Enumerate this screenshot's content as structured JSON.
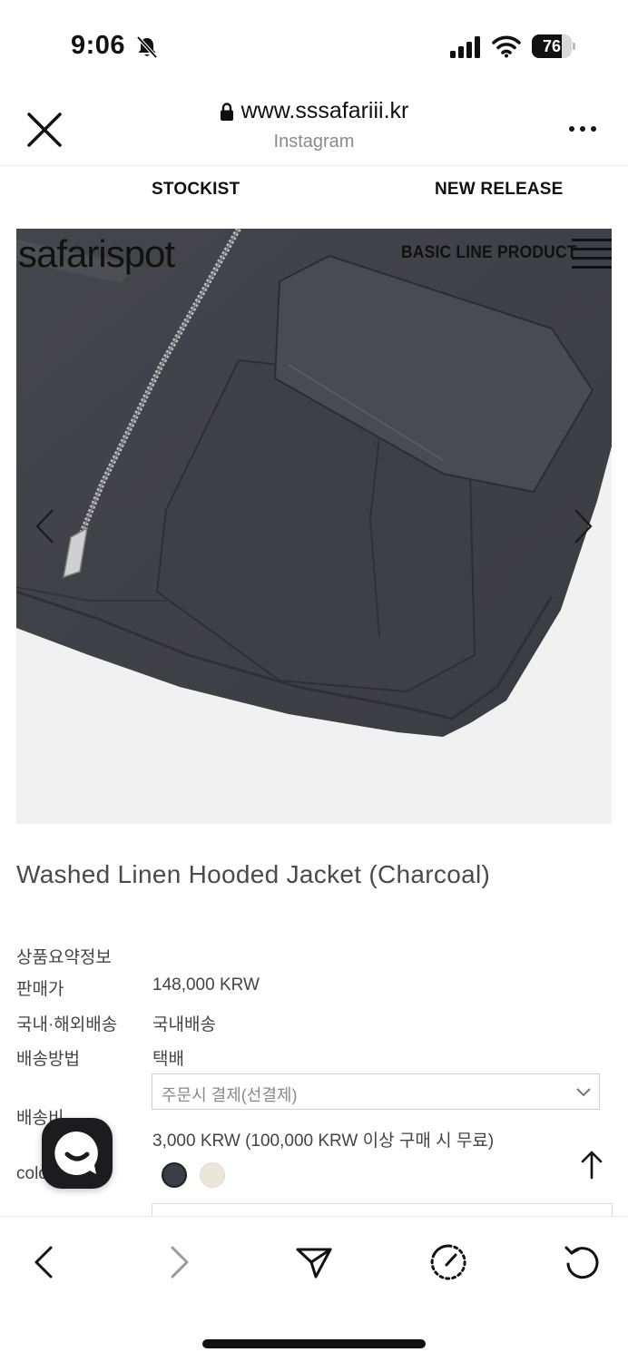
{
  "status_bar": {
    "time": "9:06",
    "battery": "76",
    "battery_percent": 76
  },
  "browser": {
    "url": "www.sssafariii.kr",
    "source": "Instagram"
  },
  "site_nav": {
    "stockist": "STOCKIST",
    "new_release": "NEW RELEASE"
  },
  "hero": {
    "brand": "safarispot",
    "line": "BASIC LINE PRODUCT"
  },
  "product": {
    "title": "Washed Linen Hooded Jacket (Charcoal)",
    "summary_label": "상품요약정보",
    "price_label": "판매가",
    "price_value": "148,000 KRW",
    "shipping_scope_label": "국내·해외배송",
    "shipping_scope_value": "국내배송",
    "shipping_method_label": "배송방법",
    "shipping_method_value": "택배",
    "shipping_fee_label": "배송비",
    "shipping_select_value": "주문시 결제(선결제)",
    "shipping_fee_value": "3,000 KRW (100,000 KRW 이상 구매 시 무료)",
    "color_label": "color",
    "swatches": [
      {
        "name": "charcoal",
        "color": "#3d3d47"
      },
      {
        "name": "ivory",
        "color": "#ebe6d8"
      }
    ]
  },
  "colors": {
    "text": "#444444",
    "chat_bg": "#1c1c1e"
  },
  "toolbar_icons": [
    "back-icon",
    "forward-icon",
    "send-icon",
    "speedometer-icon",
    "refresh-icon"
  ]
}
